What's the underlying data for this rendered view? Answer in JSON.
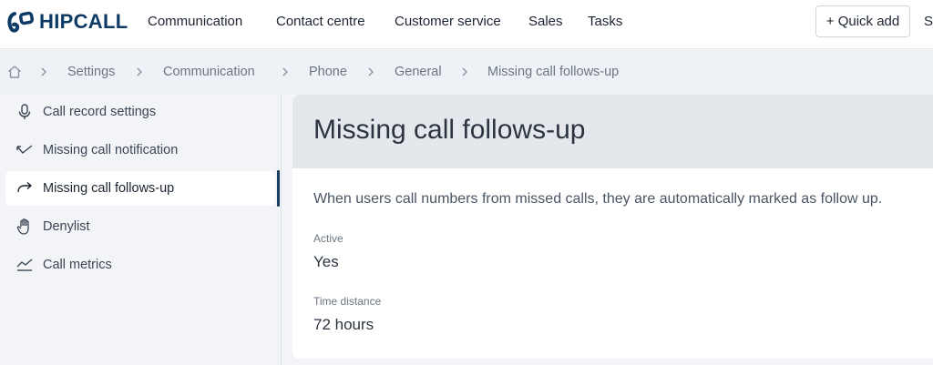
{
  "brand": {
    "name": "HIPCALL",
    "color": "#0d3b66"
  },
  "topnav": {
    "items": [
      "Communication",
      "Contact centre",
      "Customer service",
      "Sales",
      "Tasks"
    ],
    "quick_add": "+ Quick add",
    "cut_item": "Se"
  },
  "breadcrumb": {
    "home_icon": "home-icon",
    "items": [
      "Settings",
      "Communication",
      "Phone",
      "General",
      "Missing call follows-up"
    ]
  },
  "sidebar": {
    "items": [
      {
        "label": "Call record settings",
        "icon": "microphone-icon",
        "active": false
      },
      {
        "label": "Missing call notification",
        "icon": "missed-call-icon",
        "active": false
      },
      {
        "label": "Missing call follows-up",
        "icon": "forward-arrow-icon",
        "active": true
      },
      {
        "label": "Denylist",
        "icon": "hand-icon",
        "active": false
      },
      {
        "label": "Call metrics",
        "icon": "trend-line-icon",
        "active": false
      }
    ]
  },
  "main": {
    "title": "Missing call follows-up",
    "description": "When users call numbers from missed calls, they are automatically marked as follow up.",
    "fields": [
      {
        "label": "Active",
        "value": "Yes"
      },
      {
        "label": "Time distance",
        "value": "72 hours"
      }
    ]
  },
  "colors": {
    "accent": "#163e63",
    "background": "#f2f4f7",
    "header": "#e4e8ed"
  }
}
